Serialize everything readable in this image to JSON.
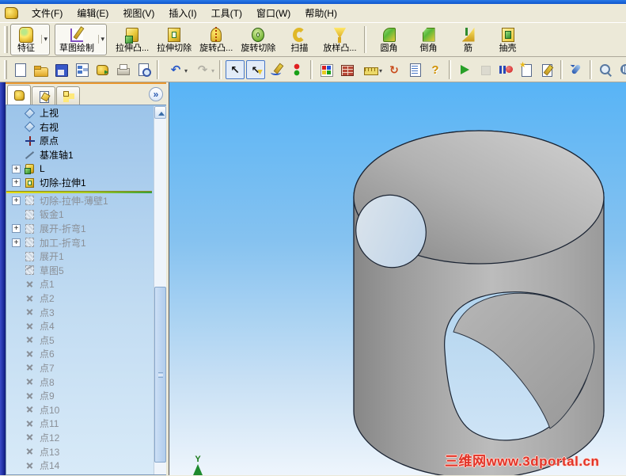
{
  "menu_bar": {
    "items": [
      "文件(F)",
      "编辑(E)",
      "视图(V)",
      "插入(I)",
      "工具(T)",
      "窗口(W)",
      "帮助(H)"
    ]
  },
  "features_toolbar": {
    "items": [
      {
        "label": "特征",
        "icon": "features",
        "dropdown": true,
        "boxed": true
      },
      {
        "label": "草图绘制",
        "icon": "sketch-draw",
        "dropdown": true,
        "boxed": true
      },
      {
        "label": "拉伸凸...",
        "icon": "extrude-boss"
      },
      {
        "label": "拉伸切除",
        "icon": "extrude-cut"
      },
      {
        "label": "旋转凸...",
        "icon": "revolve-boss"
      },
      {
        "label": "旋转切除",
        "icon": "revolve-cut"
      },
      {
        "label": "扫描",
        "icon": "sweep"
      },
      {
        "label": "放样凸...",
        "icon": "loft"
      },
      {
        "sep": true
      },
      {
        "label": "圆角",
        "icon": "fillet"
      },
      {
        "label": "倒角",
        "icon": "chamfer"
      },
      {
        "label": "筋",
        "icon": "rib"
      },
      {
        "label": "抽壳",
        "icon": "shell"
      }
    ]
  },
  "standard_toolbar": {
    "items": [
      {
        "icon": "new-document"
      },
      {
        "icon": "open-folder"
      },
      {
        "icon": "save"
      },
      {
        "icon": "make-drawing"
      },
      {
        "icon": "make-assembly"
      },
      {
        "icon": "print"
      },
      {
        "icon": "print-preview"
      },
      {
        "sep": true
      },
      {
        "icon": "undo",
        "caret": true
      },
      {
        "icon": "redo",
        "caret": true,
        "disabled": true
      },
      {
        "sep": true
      },
      {
        "icon": "select-arrow",
        "pressed": true
      },
      {
        "icon": "select-filter",
        "pressed": true
      },
      {
        "icon": "sketch-pencil"
      },
      {
        "icon": "lights"
      },
      {
        "sep": true
      },
      {
        "icon": "color-palette"
      },
      {
        "icon": "texture"
      },
      {
        "icon": "measure",
        "caret": true
      },
      {
        "icon": "section-view"
      },
      {
        "icon": "design-check"
      },
      {
        "icon": "help"
      },
      {
        "sep": true
      },
      {
        "icon": "play"
      },
      {
        "icon": "stop",
        "disabled": true
      },
      {
        "icon": "record-pause"
      },
      {
        "icon": "new-note"
      },
      {
        "icon": "edit-note"
      },
      {
        "sep": true
      },
      {
        "icon": "rotate-view"
      },
      {
        "sep": true
      },
      {
        "icon": "zoom-to-fit",
        "mag": true
      },
      {
        "icon": "zoom-to-area",
        "mag": true
      },
      {
        "icon": "zoom-in-out",
        "mag": true
      }
    ]
  },
  "feature_tree": {
    "tabs": [
      {
        "icon": "featuremanager",
        "active": true
      },
      {
        "icon": "propertymanager"
      },
      {
        "icon": "configurationmanager"
      }
    ],
    "expand_button": "»",
    "items": [
      {
        "label": "上视",
        "icon": "plane"
      },
      {
        "label": "右视",
        "icon": "plane"
      },
      {
        "label": "原点",
        "icon": "origin"
      },
      {
        "label": "基准轴1",
        "icon": "axis"
      },
      {
        "label": "L",
        "icon": "boss",
        "expandable": true
      },
      {
        "label": "切除-拉伸1",
        "icon": "cut",
        "expandable": true
      },
      {
        "rollback": true
      },
      {
        "label": "切除-拉伸-薄壁1",
        "icon": "suppressed",
        "expandable": true,
        "suppressed": true
      },
      {
        "label": "钣金1",
        "icon": "suppressed",
        "suppressed": true
      },
      {
        "label": "展开-折弯1",
        "icon": "suppressed",
        "expandable": true,
        "suppressed": true
      },
      {
        "label": "加工-折弯1",
        "icon": "suppressed",
        "expandable": true,
        "suppressed": true
      },
      {
        "label": "展开1",
        "icon": "suppressed",
        "suppressed": true
      },
      {
        "label": "草图5",
        "icon": "sketch-sup",
        "suppressed": true
      },
      {
        "label": "点1",
        "icon": "point",
        "suppressed": true
      },
      {
        "label": "点2",
        "icon": "point",
        "suppressed": true
      },
      {
        "label": "点3",
        "icon": "point",
        "suppressed": true
      },
      {
        "label": "点4",
        "icon": "point",
        "suppressed": true
      },
      {
        "label": "点5",
        "icon": "point",
        "suppressed": true
      },
      {
        "label": "点6",
        "icon": "point",
        "suppressed": true
      },
      {
        "label": "点7",
        "icon": "point",
        "suppressed": true
      },
      {
        "label": "点8",
        "icon": "point",
        "suppressed": true
      },
      {
        "label": "点9",
        "icon": "point",
        "suppressed": true
      },
      {
        "label": "点10",
        "icon": "point",
        "suppressed": true
      },
      {
        "label": "点11",
        "icon": "point",
        "suppressed": true
      },
      {
        "label": "点12",
        "icon": "point",
        "suppressed": true
      },
      {
        "label": "点13",
        "icon": "point",
        "suppressed": true
      },
      {
        "label": "点14",
        "icon": "point",
        "suppressed": true
      }
    ]
  },
  "viewport": {
    "watermark": "三维网www.3dportal.cn",
    "axis_label": "Y",
    "colors": {
      "sky_top": "#58b4f6",
      "sky_bottom": "#eef5fc",
      "model_gray": "#a9a9a9",
      "edge": "#1b2433",
      "watermark_red": "#e23428",
      "rollback_bar": "#a8cc20"
    }
  }
}
